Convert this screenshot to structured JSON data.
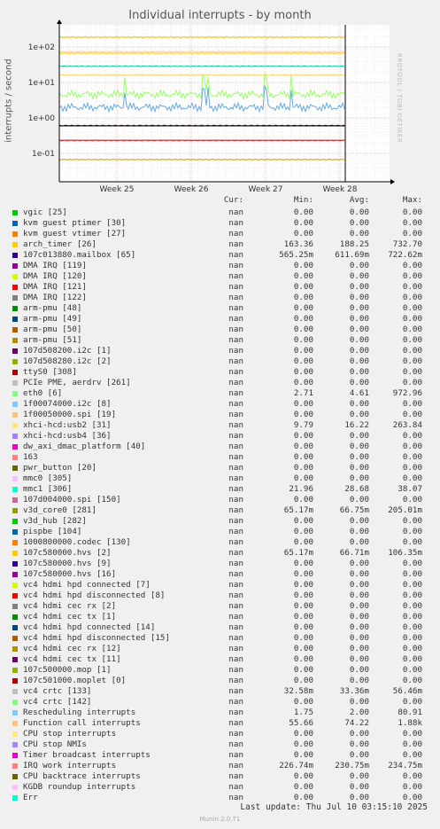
{
  "title": "Individual interrupts - by month",
  "ylabel": "interrupts / second",
  "watermark": "RRDTOOL / TOBI OETIKER",
  "headers": {
    "cur": "Cur:",
    "min": "Min:",
    "avg": "Avg:",
    "max": "Max:"
  },
  "footer": "Last update: Thu Jul 10 03:15:10 2025",
  "munin": "Munin 2.0.71",
  "chart_data": {
    "type": "line",
    "title": "Individual interrupts - by month",
    "ylabel": "interrupts / second",
    "yscale": "log",
    "yticks": [
      "1e+02",
      "1e+01",
      "1e+00",
      "1e-01"
    ],
    "xticks": [
      "Week 25",
      "Week 26",
      "Week 27",
      "Week 28"
    ],
    "series_levels": [
      {
        "name": "arch_timer [26]",
        "value": 188.25,
        "color": "#e6b800"
      },
      {
        "name": "107c580000.hvs [2]",
        "value": 66.71,
        "color": "#ffcc00"
      },
      {
        "name": "Function call interrupts",
        "value": 74.22,
        "color": "#ffcc99"
      },
      {
        "name": "mmc1 [306]",
        "value": 28.68,
        "color": "#00cc99"
      },
      {
        "name": "xhci-hcd:usb2 [31]",
        "value": 16.22,
        "color": "#ffcc66"
      },
      {
        "name": "eth0 [6]",
        "value": 4.61,
        "color": "#99ff66"
      },
      {
        "name": "Rescheduling interrupts",
        "value": 2.0,
        "color": "#66aadd"
      },
      {
        "name": "107c013880.mailbox [65]",
        "value": 0.61,
        "color": "#1a1a8c"
      },
      {
        "name": "IRQ work interrupts",
        "value": 0.23,
        "color": "#cc3333"
      },
      {
        "name": "107c580000.hvs [2]",
        "value": 0.067,
        "color": "#cc9900"
      }
    ]
  },
  "legend": [
    {
      "name": "vgic [25]",
      "color": "#00cc00",
      "cur": "nan",
      "min": "0.00",
      "avg": "0.00",
      "max": "0.00"
    },
    {
      "name": "kvm guest ptimer [30]",
      "color": "#0066b3",
      "cur": "nan",
      "min": "0.00",
      "avg": "0.00",
      "max": "0.00"
    },
    {
      "name": "kvm guest vtimer [27]",
      "color": "#ff8000",
      "cur": "nan",
      "min": "0.00",
      "avg": "0.00",
      "max": "0.00"
    },
    {
      "name": "arch_timer [26]",
      "color": "#ffcc00",
      "cur": "nan",
      "min": "163.36",
      "avg": "188.25",
      "max": "732.70"
    },
    {
      "name": "107c013880.mailbox [65]",
      "color": "#330099",
      "cur": "nan",
      "min": "565.25m",
      "avg": "611.69m",
      "max": "722.62m"
    },
    {
      "name": "DMA IRQ [119]",
      "color": "#990099",
      "cur": "nan",
      "min": "0.00",
      "avg": "0.00",
      "max": "0.00"
    },
    {
      "name": "DMA IRQ [120]",
      "color": "#ccff00",
      "cur": "nan",
      "min": "0.00",
      "avg": "0.00",
      "max": "0.00"
    },
    {
      "name": "DMA IRQ [121]",
      "color": "#ff0000",
      "cur": "nan",
      "min": "0.00",
      "avg": "0.00",
      "max": "0.00"
    },
    {
      "name": "DMA IRQ [122]",
      "color": "#808080",
      "cur": "nan",
      "min": "0.00",
      "avg": "0.00",
      "max": "0.00"
    },
    {
      "name": "arm-pmu [48]",
      "color": "#008f00",
      "cur": "nan",
      "min": "0.00",
      "avg": "0.00",
      "max": "0.00"
    },
    {
      "name": "arm-pmu [49]",
      "color": "#00487d",
      "cur": "nan",
      "min": "0.00",
      "avg": "0.00",
      "max": "0.00"
    },
    {
      "name": "arm-pmu [50]",
      "color": "#b35a00",
      "cur": "nan",
      "min": "0.00",
      "avg": "0.00",
      "max": "0.00"
    },
    {
      "name": "arm-pmu [51]",
      "color": "#b38f00",
      "cur": "nan",
      "min": "0.00",
      "avg": "0.00",
      "max": "0.00"
    },
    {
      "name": "107d508200.i2c [1]",
      "color": "#6b006b",
      "cur": "nan",
      "min": "0.00",
      "avg": "0.00",
      "max": "0.00"
    },
    {
      "name": "107d508280.i2c [2]",
      "color": "#8fb300",
      "cur": "nan",
      "min": "0.00",
      "avg": "0.00",
      "max": "0.00"
    },
    {
      "name": "ttyS0 [308]",
      "color": "#b30000",
      "cur": "nan",
      "min": "0.00",
      "avg": "0.00",
      "max": "0.00"
    },
    {
      "name": "PCIe PME, aerdrv [261]",
      "color": "#bebebe",
      "cur": "nan",
      "min": "0.00",
      "avg": "0.00",
      "max": "0.00"
    },
    {
      "name": "eth0 [6]",
      "color": "#80ff80",
      "cur": "nan",
      "min": "2.71",
      "avg": "4.61",
      "max": "972.96"
    },
    {
      "name": "1f00074000.i2c [8]",
      "color": "#80c9ff",
      "cur": "nan",
      "min": "0.00",
      "avg": "0.00",
      "max": "0.00"
    },
    {
      "name": "1f00050000.spi [19]",
      "color": "#ffc080",
      "cur": "nan",
      "min": "0.00",
      "avg": "0.00",
      "max": "0.00"
    },
    {
      "name": "xhci-hcd:usb2 [31]",
      "color": "#ffe680",
      "cur": "nan",
      "min": "9.79",
      "avg": "16.22",
      "max": "263.84"
    },
    {
      "name": "xhci-hcd:usb4 [36]",
      "color": "#aa80ff",
      "cur": "nan",
      "min": "0.00",
      "avg": "0.00",
      "max": "0.00"
    },
    {
      "name": "dw_axi_dmac_platform [40]",
      "color": "#ee00cc",
      "cur": "nan",
      "min": "0.00",
      "avg": "0.00",
      "max": "0.00"
    },
    {
      "name": "163",
      "color": "#ff8080",
      "cur": "nan",
      "min": "0.00",
      "avg": "0.00",
      "max": "0.00"
    },
    {
      "name": "pwr_button [20]",
      "color": "#666600",
      "cur": "nan",
      "min": "0.00",
      "avg": "0.00",
      "max": "0.00"
    },
    {
      "name": "mmc0 [305]",
      "color": "#ffbfff",
      "cur": "nan",
      "min": "0.00",
      "avg": "0.00",
      "max": "0.00"
    },
    {
      "name": "mmc1 [306]",
      "color": "#00ffcc",
      "cur": "nan",
      "min": "21.96",
      "avg": "28.68",
      "max": "38.07"
    },
    {
      "name": "107d004000.spi [150]",
      "color": "#cc6699",
      "cur": "nan",
      "min": "0.00",
      "avg": "0.00",
      "max": "0.00"
    },
    {
      "name": "v3d_core0 [281]",
      "color": "#999900",
      "cur": "nan",
      "min": "65.17m",
      "avg": "66.75m",
      "max": "205.01m"
    },
    {
      "name": "v3d_hub [282]",
      "color": "#00cc00",
      "cur": "nan",
      "min": "0.00",
      "avg": "0.00",
      "max": "0.00"
    },
    {
      "name": "pispbe [104]",
      "color": "#0066b3",
      "cur": "nan",
      "min": "0.00",
      "avg": "0.00",
      "max": "0.00"
    },
    {
      "name": "1000800000.codec [130]",
      "color": "#ff8000",
      "cur": "nan",
      "min": "0.00",
      "avg": "0.00",
      "max": "0.00"
    },
    {
      "name": "107c580000.hvs [2]",
      "color": "#ffcc00",
      "cur": "nan",
      "min": "65.17m",
      "avg": "66.71m",
      "max": "106.35m"
    },
    {
      "name": "107c580000.hvs [9]",
      "color": "#330099",
      "cur": "nan",
      "min": "0.00",
      "avg": "0.00",
      "max": "0.00"
    },
    {
      "name": "107c580000.hvs [16]",
      "color": "#990099",
      "cur": "nan",
      "min": "0.00",
      "avg": "0.00",
      "max": "0.00"
    },
    {
      "name": "vc4 hdmi hpd connected [7]",
      "color": "#ccff00",
      "cur": "nan",
      "min": "0.00",
      "avg": "0.00",
      "max": "0.00"
    },
    {
      "name": "vc4 hdmi hpd disconnected [8]",
      "color": "#ff0000",
      "cur": "nan",
      "min": "0.00",
      "avg": "0.00",
      "max": "0.00"
    },
    {
      "name": "vc4 hdmi cec rx [2]",
      "color": "#808080",
      "cur": "nan",
      "min": "0.00",
      "avg": "0.00",
      "max": "0.00"
    },
    {
      "name": "vc4 hdmi cec tx [1]",
      "color": "#008f00",
      "cur": "nan",
      "min": "0.00",
      "avg": "0.00",
      "max": "0.00"
    },
    {
      "name": "vc4 hdmi hpd connected [14]",
      "color": "#00487d",
      "cur": "nan",
      "min": "0.00",
      "avg": "0.00",
      "max": "0.00"
    },
    {
      "name": "vc4 hdmi hpd disconnected [15]",
      "color": "#b35a00",
      "cur": "nan",
      "min": "0.00",
      "avg": "0.00",
      "max": "0.00"
    },
    {
      "name": "vc4 hdmi cec rx [12]",
      "color": "#b38f00",
      "cur": "nan",
      "min": "0.00",
      "avg": "0.00",
      "max": "0.00"
    },
    {
      "name": "vc4 hdmi cec tx [11]",
      "color": "#6b006b",
      "cur": "nan",
      "min": "0.00",
      "avg": "0.00",
      "max": "0.00"
    },
    {
      "name": "107c500000.mop [1]",
      "color": "#8fb300",
      "cur": "nan",
      "min": "0.00",
      "avg": "0.00",
      "max": "0.00"
    },
    {
      "name": "107c501000.moplet [0]",
      "color": "#b30000",
      "cur": "nan",
      "min": "0.00",
      "avg": "0.00",
      "max": "0.00"
    },
    {
      "name": "vc4 crtc [133]",
      "color": "#bebebe",
      "cur": "nan",
      "min": "32.58m",
      "avg": "33.36m",
      "max": "56.46m"
    },
    {
      "name": "vc4 crtc [142]",
      "color": "#80ff80",
      "cur": "nan",
      "min": "0.00",
      "avg": "0.00",
      "max": "0.00"
    },
    {
      "name": "Rescheduling interrupts",
      "color": "#80c9ff",
      "cur": "nan",
      "min": "1.75",
      "avg": "2.00",
      "max": "80.91"
    },
    {
      "name": "Function call interrupts",
      "color": "#ffc080",
      "cur": "nan",
      "min": "55.66",
      "avg": "74.22",
      "max": "1.88k"
    },
    {
      "name": "CPU stop interrupts",
      "color": "#ffe680",
      "cur": "nan",
      "min": "0.00",
      "avg": "0.00",
      "max": "0.00"
    },
    {
      "name": "CPU stop NMIs",
      "color": "#aa80ff",
      "cur": "nan",
      "min": "0.00",
      "avg": "0.00",
      "max": "0.00"
    },
    {
      "name": "Timer broadcast interrupts",
      "color": "#ee00cc",
      "cur": "nan",
      "min": "0.00",
      "avg": "0.00",
      "max": "0.00"
    },
    {
      "name": "IRQ work interrupts",
      "color": "#ff8080",
      "cur": "nan",
      "min": "226.74m",
      "avg": "230.75m",
      "max": "234.75m"
    },
    {
      "name": "CPU backtrace interrupts",
      "color": "#666600",
      "cur": "nan",
      "min": "0.00",
      "avg": "0.00",
      "max": "0.00"
    },
    {
      "name": "KGDB roundup interrupts",
      "color": "#ffbfff",
      "cur": "nan",
      "min": "0.00",
      "avg": "0.00",
      "max": "0.00"
    },
    {
      "name": "Err",
      "color": "#00ffcc",
      "cur": "nan",
      "min": "0.00",
      "avg": "0.00",
      "max": "0.00"
    }
  ]
}
